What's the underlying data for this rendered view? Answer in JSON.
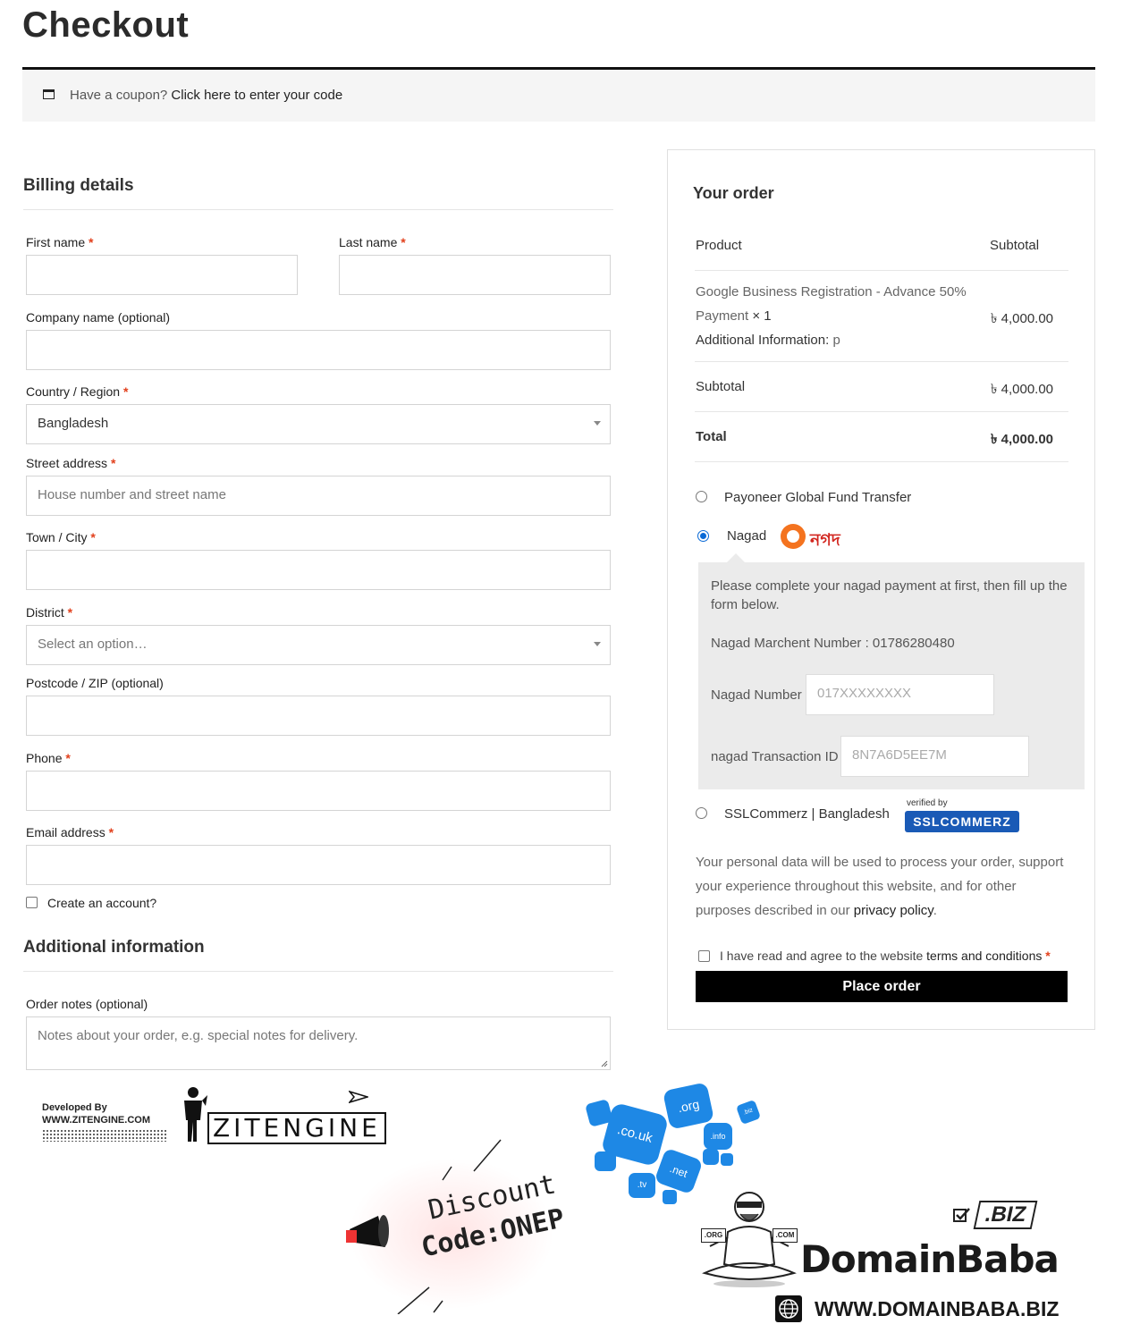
{
  "page": {
    "title": "Checkout",
    "coupon": {
      "prefix": "Have a coupon?",
      "link": "Click here to enter your code"
    }
  },
  "billing": {
    "heading": "Billing details",
    "first_name": {
      "label": "First name",
      "value": ""
    },
    "last_name": {
      "label": "Last name",
      "value": ""
    },
    "company": {
      "label": "Company name (optional)",
      "value": ""
    },
    "country": {
      "label": "Country / Region",
      "value": "Bangladesh"
    },
    "street": {
      "label": "Street address",
      "placeholder": "House number and street name"
    },
    "city": {
      "label": "Town / City",
      "value": ""
    },
    "district": {
      "label": "District",
      "placeholder": "Select an option…"
    },
    "postcode": {
      "label": "Postcode / ZIP (optional)",
      "value": ""
    },
    "phone": {
      "label": "Phone",
      "value": ""
    },
    "email": {
      "label": "Email address",
      "value": ""
    },
    "create_account": "Create an account?",
    "required_mark": "*"
  },
  "additional": {
    "heading": "Additional information",
    "notes_label": "Order notes (optional)",
    "notes_placeholder": "Notes about your order, e.g. special notes for delivery."
  },
  "order": {
    "heading": "Your order",
    "col_product": "Product",
    "col_subtotal": "Subtotal",
    "item_name_1": "Google Business Registration - Advance 50%",
    "item_name_2": "Payment",
    "item_qty": "× 1",
    "item_info_label": "Additional Information:",
    "item_info_value": "p",
    "item_price": "৳ 4,000.00",
    "subtotal_label": "Subtotal",
    "subtotal_value": "৳ 4,000.00",
    "total_label": "Total",
    "total_value": "৳ 4,000.00"
  },
  "payment": {
    "payoneer": "Payoneer Global Fund Transfer",
    "nagad": "Nagad",
    "nagad_logo_text": "নগদ",
    "nagad_instructions": "Please complete your nagad payment at first, then fill up the form below.",
    "merchant_line": "Nagad Marchent Number : 01786280480",
    "nagad_number_label": "Nagad Number",
    "nagad_number_placeholder": "017XXXXXXXX",
    "txn_label": "nagad Transaction ID",
    "txn_placeholder": "8N7A6D5EE7M",
    "ssl": "SSLCommerz | Bangladesh",
    "ssl_caption": "verified by",
    "ssl_logo_text": "SSLCOMMERZ"
  },
  "privacy": {
    "text": "Your personal data will be used to process your order, support your experience throughout this website, and for other purposes described in our",
    "link": "privacy policy",
    "end": "."
  },
  "terms": {
    "prefix": "I have read and agree to the website",
    "link": "terms and conditions",
    "required_mark": "*"
  },
  "place_order": "Place order",
  "ads": {
    "developed_by": "Developed By",
    "dev_site": "WWW.ZITENGINE.COM",
    "zit_logo": "ZITENGINE",
    "discount_1": "Discount",
    "discount_2": "Code:ONEP",
    "tld_bubbles": [
      ".org",
      ".co.uk",
      ".info",
      ".net",
      ".tv",
      ".biz"
    ],
    "biz_badge": ".BIZ",
    "baba_org": ".ORG",
    "baba_com": ".COM",
    "brand": "DomainBaba",
    "brand_site": "WWW.DOMAINBABA.BIZ"
  },
  "colors": {
    "required": "#e2401c",
    "radio_on": "#0a6ad6",
    "button": "#000000",
    "panel": "#ebebeb",
    "ssl_blue": "#1a5ab6",
    "nagad_orange": "#f4731f"
  }
}
